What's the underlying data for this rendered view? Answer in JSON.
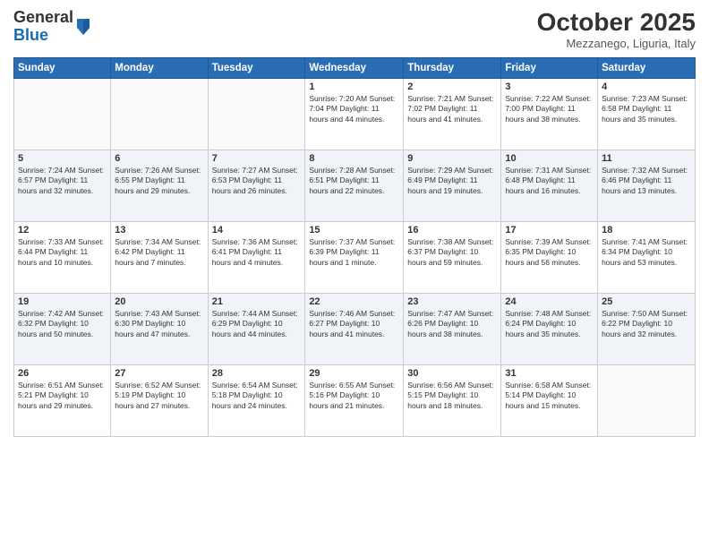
{
  "header": {
    "logo_line1": "General",
    "logo_line2": "Blue",
    "month": "October 2025",
    "location": "Mezzanego, Liguria, Italy"
  },
  "days_of_week": [
    "Sunday",
    "Monday",
    "Tuesday",
    "Wednesday",
    "Thursday",
    "Friday",
    "Saturday"
  ],
  "weeks": [
    [
      {
        "day": "",
        "info": ""
      },
      {
        "day": "",
        "info": ""
      },
      {
        "day": "",
        "info": ""
      },
      {
        "day": "1",
        "info": "Sunrise: 7:20 AM\nSunset: 7:04 PM\nDaylight: 11 hours\nand 44 minutes."
      },
      {
        "day": "2",
        "info": "Sunrise: 7:21 AM\nSunset: 7:02 PM\nDaylight: 11 hours\nand 41 minutes."
      },
      {
        "day": "3",
        "info": "Sunrise: 7:22 AM\nSunset: 7:00 PM\nDaylight: 11 hours\nand 38 minutes."
      },
      {
        "day": "4",
        "info": "Sunrise: 7:23 AM\nSunset: 6:58 PM\nDaylight: 11 hours\nand 35 minutes."
      }
    ],
    [
      {
        "day": "5",
        "info": "Sunrise: 7:24 AM\nSunset: 6:57 PM\nDaylight: 11 hours\nand 32 minutes."
      },
      {
        "day": "6",
        "info": "Sunrise: 7:26 AM\nSunset: 6:55 PM\nDaylight: 11 hours\nand 29 minutes."
      },
      {
        "day": "7",
        "info": "Sunrise: 7:27 AM\nSunset: 6:53 PM\nDaylight: 11 hours\nand 26 minutes."
      },
      {
        "day": "8",
        "info": "Sunrise: 7:28 AM\nSunset: 6:51 PM\nDaylight: 11 hours\nand 22 minutes."
      },
      {
        "day": "9",
        "info": "Sunrise: 7:29 AM\nSunset: 6:49 PM\nDaylight: 11 hours\nand 19 minutes."
      },
      {
        "day": "10",
        "info": "Sunrise: 7:31 AM\nSunset: 6:48 PM\nDaylight: 11 hours\nand 16 minutes."
      },
      {
        "day": "11",
        "info": "Sunrise: 7:32 AM\nSunset: 6:46 PM\nDaylight: 11 hours\nand 13 minutes."
      }
    ],
    [
      {
        "day": "12",
        "info": "Sunrise: 7:33 AM\nSunset: 6:44 PM\nDaylight: 11 hours\nand 10 minutes."
      },
      {
        "day": "13",
        "info": "Sunrise: 7:34 AM\nSunset: 6:42 PM\nDaylight: 11 hours\nand 7 minutes."
      },
      {
        "day": "14",
        "info": "Sunrise: 7:36 AM\nSunset: 6:41 PM\nDaylight: 11 hours\nand 4 minutes."
      },
      {
        "day": "15",
        "info": "Sunrise: 7:37 AM\nSunset: 6:39 PM\nDaylight: 11 hours\nand 1 minute."
      },
      {
        "day": "16",
        "info": "Sunrise: 7:38 AM\nSunset: 6:37 PM\nDaylight: 10 hours\nand 59 minutes."
      },
      {
        "day": "17",
        "info": "Sunrise: 7:39 AM\nSunset: 6:35 PM\nDaylight: 10 hours\nand 56 minutes."
      },
      {
        "day": "18",
        "info": "Sunrise: 7:41 AM\nSunset: 6:34 PM\nDaylight: 10 hours\nand 53 minutes."
      }
    ],
    [
      {
        "day": "19",
        "info": "Sunrise: 7:42 AM\nSunset: 6:32 PM\nDaylight: 10 hours\nand 50 minutes."
      },
      {
        "day": "20",
        "info": "Sunrise: 7:43 AM\nSunset: 6:30 PM\nDaylight: 10 hours\nand 47 minutes."
      },
      {
        "day": "21",
        "info": "Sunrise: 7:44 AM\nSunset: 6:29 PM\nDaylight: 10 hours\nand 44 minutes."
      },
      {
        "day": "22",
        "info": "Sunrise: 7:46 AM\nSunset: 6:27 PM\nDaylight: 10 hours\nand 41 minutes."
      },
      {
        "day": "23",
        "info": "Sunrise: 7:47 AM\nSunset: 6:26 PM\nDaylight: 10 hours\nand 38 minutes."
      },
      {
        "day": "24",
        "info": "Sunrise: 7:48 AM\nSunset: 6:24 PM\nDaylight: 10 hours\nand 35 minutes."
      },
      {
        "day": "25",
        "info": "Sunrise: 7:50 AM\nSunset: 6:22 PM\nDaylight: 10 hours\nand 32 minutes."
      }
    ],
    [
      {
        "day": "26",
        "info": "Sunrise: 6:51 AM\nSunset: 5:21 PM\nDaylight: 10 hours\nand 29 minutes."
      },
      {
        "day": "27",
        "info": "Sunrise: 6:52 AM\nSunset: 5:19 PM\nDaylight: 10 hours\nand 27 minutes."
      },
      {
        "day": "28",
        "info": "Sunrise: 6:54 AM\nSunset: 5:18 PM\nDaylight: 10 hours\nand 24 minutes."
      },
      {
        "day": "29",
        "info": "Sunrise: 6:55 AM\nSunset: 5:16 PM\nDaylight: 10 hours\nand 21 minutes."
      },
      {
        "day": "30",
        "info": "Sunrise: 6:56 AM\nSunset: 5:15 PM\nDaylight: 10 hours\nand 18 minutes."
      },
      {
        "day": "31",
        "info": "Sunrise: 6:58 AM\nSunset: 5:14 PM\nDaylight: 10 hours\nand 15 minutes."
      },
      {
        "day": "",
        "info": ""
      }
    ]
  ]
}
